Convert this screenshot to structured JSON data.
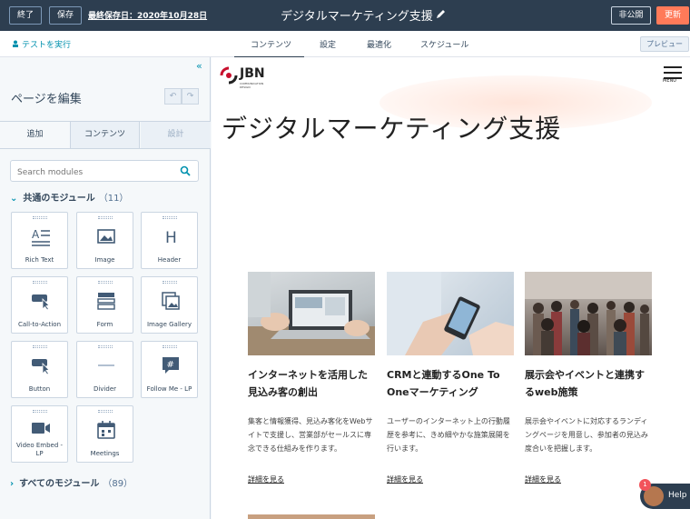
{
  "topbar": {
    "exit_label": "終了",
    "save_label": "保存",
    "last_saved": "最終保存日：2020年10月28日",
    "page_title": "デジタルマーケティング支援",
    "unpublish_label": "非公開",
    "update_label": "更新"
  },
  "subbar": {
    "test_run": "テストを実行",
    "tabs": [
      "コンテンツ",
      "設定",
      "最適化",
      "スケジュール"
    ],
    "preview": "プレビュー"
  },
  "sidebar": {
    "title": "ページを編集",
    "tabs": [
      "追加",
      "コンテンツ",
      "設計"
    ],
    "search_placeholder": "Search modules",
    "common_section": "共通のモジュール",
    "common_count": "（11）",
    "all_section": "すべてのモジュール",
    "all_count": "（89）",
    "modules": [
      {
        "label": "Rich Text",
        "icon": "rich-text-icon"
      },
      {
        "label": "Image",
        "icon": "image-icon"
      },
      {
        "label": "Header",
        "icon": "header-icon"
      },
      {
        "label": "Call-to-Action",
        "icon": "cta-icon"
      },
      {
        "label": "Form",
        "icon": "form-icon"
      },
      {
        "label": "Image Gallery",
        "icon": "gallery-icon"
      },
      {
        "label": "Button",
        "icon": "button-icon"
      },
      {
        "label": "Divider",
        "icon": "divider-icon"
      },
      {
        "label": "Follow Me - LP",
        "icon": "hashtag-icon"
      },
      {
        "label": "Video Embed - LP",
        "icon": "video-icon"
      },
      {
        "label": "Meetings",
        "icon": "calendar-icon"
      }
    ]
  },
  "canvas": {
    "logo": "JBN",
    "logo_sub": "COMMUNICATION DESIGN",
    "menu_label": "MENU",
    "heading": "デジタルマーケティング支援",
    "cards": [
      {
        "title": "インターネットを活用した見込み客の創出",
        "desc": "集客と情報獲得、見込み客化をWebサイトで支援し、営業部がセールスに専念できる仕組みを作ります。",
        "more": "詳細を見る"
      },
      {
        "title": "CRMと連動するOne To Oneマーケティング",
        "desc": "ユーザーのインターネット上の行動履歴を参考に、きめ細やかな施策展開を行います。",
        "more": "詳細を見る"
      },
      {
        "title": "展示会やイベントと連携するweb施策",
        "desc": "展示会やイベントに対応するランディングページを用意し、参加者の見込み度合いを把握します。",
        "more": "詳細を見る"
      }
    ]
  },
  "help": {
    "label": "Help",
    "badge": "1"
  }
}
